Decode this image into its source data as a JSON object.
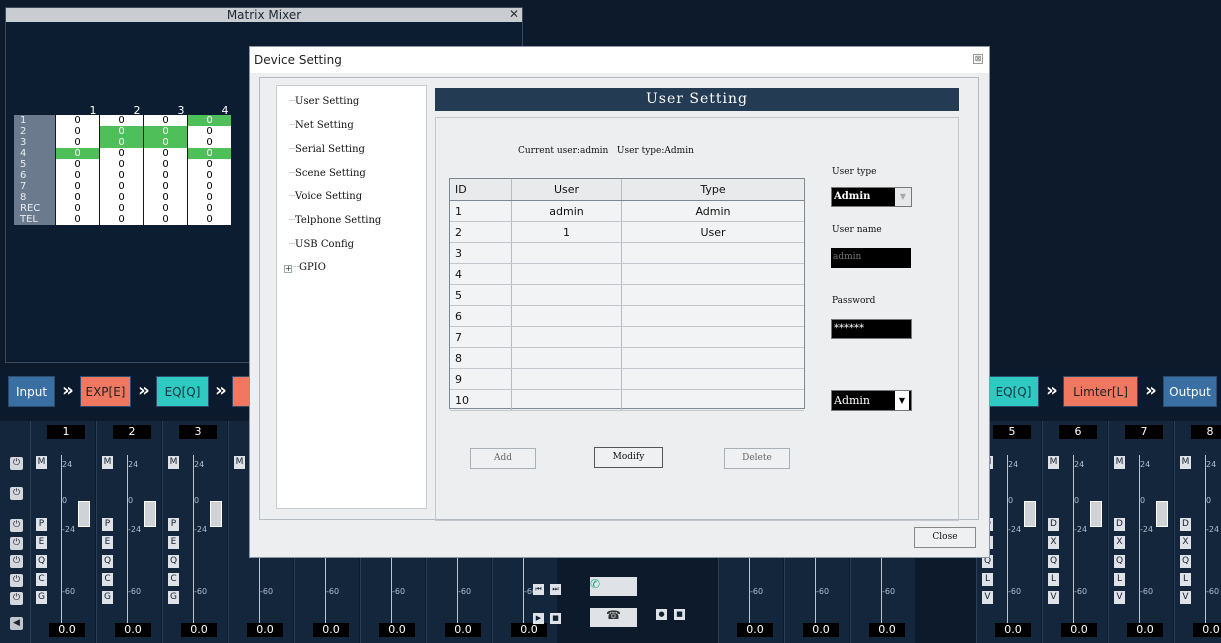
{
  "matrix": {
    "title": "Matrix Mixer",
    "col_headers": [
      "1",
      "2",
      "3",
      "4"
    ],
    "rows": [
      {
        "label": "1",
        "cells": [
          "0",
          "0",
          "0",
          "0"
        ]
      },
      {
        "label": "2",
        "cells": [
          "0",
          "0",
          "0",
          "0"
        ]
      },
      {
        "label": "3",
        "cells": [
          "0",
          "0",
          "0",
          "0"
        ]
      },
      {
        "label": "4",
        "cells": [
          "0",
          "0",
          "0",
          "0"
        ]
      },
      {
        "label": "5",
        "cells": [
          "0",
          "0",
          "0",
          "0"
        ]
      },
      {
        "label": "6",
        "cells": [
          "0",
          "0",
          "0",
          "0"
        ]
      },
      {
        "label": "7",
        "cells": [
          "0",
          "0",
          "0",
          "0"
        ]
      },
      {
        "label": "8",
        "cells": [
          "0",
          "0",
          "0",
          "0"
        ]
      },
      {
        "label": "REC",
        "cells": [
          "0",
          "0",
          "0",
          "0"
        ]
      },
      {
        "label": "TEL",
        "cells": [
          "0",
          "0",
          "0",
          "0"
        ]
      }
    ]
  },
  "dialog": {
    "title": "Device Setting",
    "close_glyph": "⊠",
    "tree": [
      "User Setting",
      "Net Setting",
      "Serial Setting",
      "Scene Setting",
      "Voice Setting",
      "Telphone Setting",
      "USB Config",
      "GPIO"
    ],
    "tree_expand": "+",
    "header": "User Setting",
    "current_user": "Current user:admin",
    "user_type_info": "User type:Admin",
    "table": {
      "headers": [
        "ID",
        "User",
        "Type"
      ],
      "rows": [
        {
          "id": "1",
          "user": "admin",
          "type": "Admin"
        },
        {
          "id": "2",
          "user": "1",
          "type": "User"
        },
        {
          "id": "3",
          "user": "",
          "type": ""
        },
        {
          "id": "4",
          "user": "",
          "type": ""
        },
        {
          "id": "5",
          "user": "",
          "type": ""
        },
        {
          "id": "6",
          "user": "",
          "type": ""
        },
        {
          "id": "7",
          "user": "",
          "type": ""
        },
        {
          "id": "8",
          "user": "",
          "type": ""
        },
        {
          "id": "9",
          "user": "",
          "type": ""
        },
        {
          "id": "10",
          "user": "",
          "type": ""
        }
      ]
    },
    "user_type_label": "User type",
    "user_type_value": "Admin",
    "user_name_label": "User name",
    "user_name_value": "admin",
    "password_label": "Password",
    "password_value": "******",
    "level_value": "Admin",
    "add_label": "Add",
    "modify_label": "Modify",
    "delete_label": "Delete",
    "close_label": "Close"
  },
  "chain": {
    "input": "Input",
    "exp": "EXP[E]",
    "eq_left": "EQ[Q]",
    "eq_right": "EQ[Q]",
    "limiter": "Limter[L]",
    "output": "Output",
    "arrow": "»",
    "colors": {
      "input": "#3a6fa3",
      "exp": "#f07860",
      "eq": "#2ec9c0",
      "limiter": "#f07860",
      "output": "#3a6fa3"
    }
  },
  "channels_left": [
    {
      "num": "1",
      "value": "0.0",
      "btns": [
        "P",
        "E",
        "Q",
        "C",
        "G"
      ]
    },
    {
      "num": "2",
      "value": "0.0",
      "btns": [
        "P",
        "E",
        "Q",
        "C",
        "G"
      ]
    },
    {
      "num": "3",
      "value": "0.0",
      "btns": [
        "P",
        "E",
        "Q",
        "C",
        "G"
      ]
    }
  ],
  "channels_right": [
    {
      "num": "5",
      "value": "0.0",
      "btns": [
        "D",
        "X",
        "Q",
        "L",
        "V"
      ]
    },
    {
      "num": "6",
      "value": "0.0",
      "btns": [
        "D",
        "X",
        "Q",
        "L",
        "V"
      ]
    },
    {
      "num": "7",
      "value": "0.0",
      "btns": [
        "D",
        "X",
        "Q",
        "L",
        "V"
      ]
    },
    {
      "num": "8",
      "value": "0.0",
      "btns": [
        "D",
        "X",
        "Q",
        "L",
        "V"
      ]
    }
  ],
  "hidden_channel_values": [
    "0.0",
    "0.0",
    "0.0",
    "0.0",
    "0.0",
    "0.0",
    "0.0",
    "0.0"
  ],
  "meter_labels": {
    "top": "24",
    "mid": "0",
    "low": "-24",
    "bottom": "-60"
  },
  "mute_label": "M",
  "playback": {
    "prev": "⏮",
    "next": "⏭",
    "play": "▶",
    "stop": "■"
  }
}
